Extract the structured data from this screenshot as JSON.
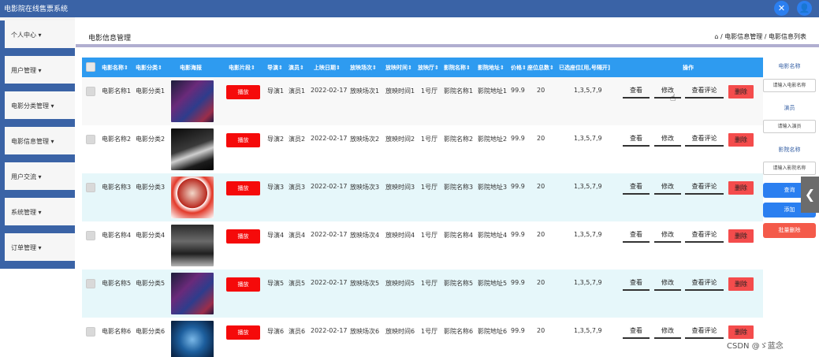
{
  "app": {
    "title": "电影院在线售票系统"
  },
  "topbar": {
    "expand_icon": "✕",
    "user_icon": "👤"
  },
  "sidebar": {
    "items": [
      {
        "label": "个人中心",
        "caret": "▾"
      },
      {
        "label": "用户管理",
        "caret": "▾"
      },
      {
        "label": "电影分类管理",
        "caret": "▾"
      },
      {
        "label": "电影信息管理",
        "caret": "▾"
      },
      {
        "label": "用户交流",
        "caret": "▾"
      },
      {
        "label": "系统管理",
        "caret": "▾"
      },
      {
        "label": "订单管理",
        "caret": "▾"
      }
    ]
  },
  "header": {
    "page_title": "电影信息管理",
    "home_icon": "⌂",
    "breadcrumb": "/ 电影信息管理 / 电影信息列表"
  },
  "table": {
    "columns": [
      "电影名称",
      "电影分类",
      "电影海报",
      "电影片段",
      "导演",
      "演员",
      "上映日期",
      "放映场次",
      "放映时间",
      "放映厅",
      "影院名称",
      "影院地址",
      "价格",
      "座位总数",
      "已选座位[用,号隔开]",
      "操作"
    ],
    "sort_mark": "⇕",
    "play_label": "播放",
    "actions": {
      "view": "查看",
      "edit": "修改",
      "review": "查看评论",
      "delete": "删除"
    },
    "rows": [
      {
        "name": "电影名称1",
        "category": "电影分类1",
        "director": "导演1",
        "actor": "演员1",
        "date": "2022-02-17",
        "session": "放映场次1",
        "time": "放映时间1",
        "hall": "1号厅",
        "cinema": "影院名称1",
        "address": "影院地址1",
        "price": "99.9",
        "seats": "20",
        "selected": "1,3,5,7,9"
      },
      {
        "name": "电影名称2",
        "category": "电影分类2",
        "director": "导演2",
        "actor": "演员2",
        "date": "2022-02-17",
        "session": "放映场次2",
        "time": "放映时间2",
        "hall": "1号厅",
        "cinema": "影院名称2",
        "address": "影院地址2",
        "price": "99.9",
        "seats": "20",
        "selected": "1,3,5,7,9"
      },
      {
        "name": "电影名称3",
        "category": "电影分类3",
        "director": "导演3",
        "actor": "演员3",
        "date": "2022-02-17",
        "session": "放映场次3",
        "time": "放映时间3",
        "hall": "1号厅",
        "cinema": "影院名称3",
        "address": "影院地址3",
        "price": "99.9",
        "seats": "20",
        "selected": "1,3,5,7,9"
      },
      {
        "name": "电影名称4",
        "category": "电影分类4",
        "director": "导演4",
        "actor": "演员4",
        "date": "2022-02-17",
        "session": "放映场次4",
        "time": "放映时间4",
        "hall": "1号厅",
        "cinema": "影院名称4",
        "address": "影院地址4",
        "price": "99.9",
        "seats": "20",
        "selected": "1,3,5,7,9"
      },
      {
        "name": "电影名称5",
        "category": "电影分类5",
        "director": "导演5",
        "actor": "演员5",
        "date": "2022-02-17",
        "session": "放映场次5",
        "time": "放映时间5",
        "hall": "1号厅",
        "cinema": "影院名称5",
        "address": "影院地址5",
        "price": "99.9",
        "seats": "20",
        "selected": "1,3,5,7,9"
      },
      {
        "name": "电影名称6",
        "category": "电影分类6",
        "director": "导演6",
        "actor": "演员6",
        "date": "2022-02-17",
        "session": "放映场次6",
        "time": "放映时间6",
        "hall": "1号厅",
        "cinema": "影院名称6",
        "address": "影院地址6",
        "price": "99.9",
        "seats": "20",
        "selected": "1,3,5,7,9"
      }
    ]
  },
  "search_panel": {
    "movie_label": "电影名称",
    "movie_placeholder": "请输入电影名称",
    "actor_label": "演员",
    "actor_placeholder": "请输入演员",
    "cinema_label": "影院名称",
    "cinema_placeholder": "请输入影院名称",
    "query_button": "查询",
    "add_button": "添加",
    "batch_delete_button": "批量删除"
  },
  "side_toggle": {
    "icon": "❮"
  },
  "watermark": "CSDN @ゞ蓝念",
  "colors": {
    "header_blue": "#3a63a6",
    "table_head": "#2e9bf0",
    "play_red": "#f50a0a",
    "delete_red": "#f44c4c",
    "primary_blue": "#2b7ff0"
  }
}
